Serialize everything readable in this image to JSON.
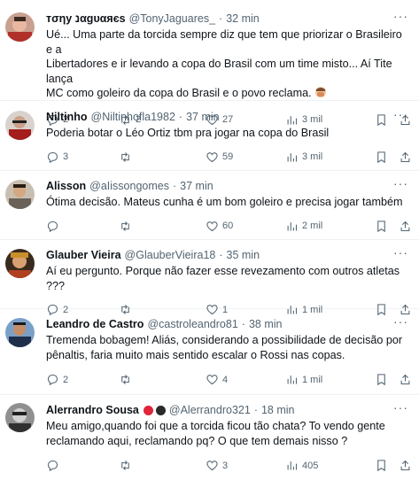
{
  "tweets": [
    {
      "name": "тσηу נαgυαяєѕ",
      "handle": "@TonyJaguares_",
      "sep": "·",
      "time": "32 min",
      "lines": [
        "Ué... Uma parte da torcida sempre diz que tem que priorizar o Brasileiro e a",
        "Libertadores e ir levando a copa do Brasil com um time misto... Aí Tite lança",
        "MC como goleiro da copa do Brasil e o povo reclama."
      ],
      "replies": "2",
      "retweets": "2",
      "likes": "27",
      "views": "3 mil"
    },
    {
      "name": "Niltinho",
      "handle": "@Niltinhofla1982",
      "sep": "·",
      "time": "37 min",
      "lines": [
        "Poderia botar o Léo Ortiz tbm pra jogar na copa do Brasil"
      ],
      "replies": "3",
      "retweets": "",
      "likes": "59",
      "views": "3 mil"
    },
    {
      "name": "Alisson",
      "handle": "@aIissongomes",
      "sep": "·",
      "time": "37 min",
      "lines": [
        "Ótima decisão. Mateus cunha é um bom goleiro e precisa jogar também"
      ],
      "replies": "",
      "retweets": "",
      "likes": "60",
      "views": "2 mil"
    },
    {
      "name": "Glauber Vieira",
      "handle": "@GlauberVieira18",
      "sep": "·",
      "time": "35 min",
      "lines": [
        "Aí eu pergunto. Porque não fazer esse revezamento com outros atletas ???"
      ],
      "replies": "2",
      "retweets": "",
      "likes": "1",
      "views": "1 mil"
    },
    {
      "name": "Leandro de Castro",
      "handle": "@castroleandro81",
      "sep": "·",
      "time": "38 min",
      "lines": [
        "Tremenda bobagem! Aliás, considerando a possibilidade de decisão por",
        "pênaltis, faria muito mais sentido escalar o Rossi nas copas."
      ],
      "replies": "2",
      "retweets": "",
      "likes": "4",
      "views": "1 mil"
    },
    {
      "name": "Alerrandro Sousa",
      "handle": "@Alerrandro321",
      "sep": "·",
      "time": "18 min",
      "lines": [
        "Meu amigo,quando foi que a torcida ficou tão chata? To vendo gente",
        "reclamando aqui, reclamando pq? O que tem demais nisso ?"
      ],
      "replies": "",
      "retweets": "",
      "likes": "3",
      "views": "405"
    }
  ],
  "colors": {
    "text": "#0f1419",
    "secondary": "#536471",
    "divider": "#eff3f4"
  },
  "icons": [
    "reply-icon",
    "retweet-icon",
    "like-icon",
    "views-icon",
    "bookmark-icon",
    "share-icon",
    "more-icon"
  ]
}
